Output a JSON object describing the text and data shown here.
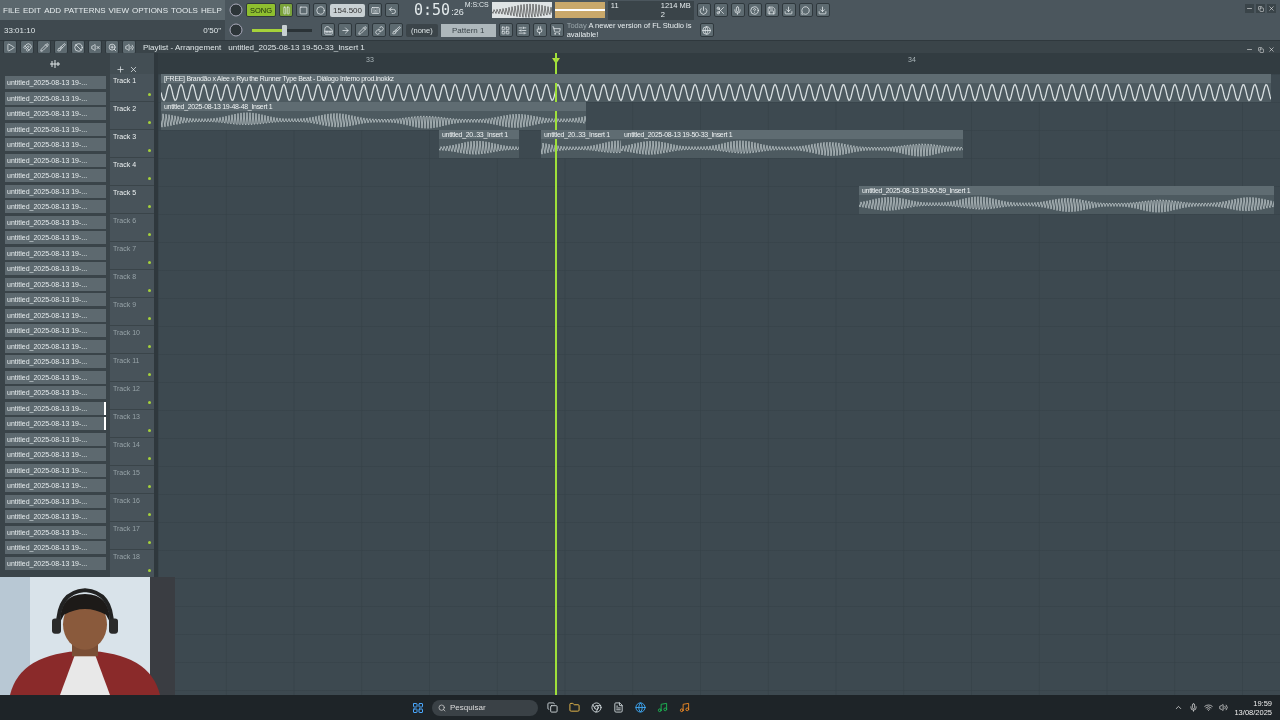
{
  "menu": [
    "FILE",
    "EDIT",
    "ADD",
    "PATTERNS",
    "VIEW",
    "OPTIONS",
    "TOOLS",
    "HELP"
  ],
  "song_position": "33:01:10",
  "hint_time": "0'50\"",
  "transport": {
    "mode_label": "SONG",
    "song_mode": true,
    "tempo": "154.500"
  },
  "master_volume": {
    "level": 0.55
  },
  "time_display": {
    "main": "0:50",
    "sub": ":26",
    "unit": "M:S:CS"
  },
  "cpu": {
    "value": "11",
    "memory": "1214 MB",
    "polyphony": "2"
  },
  "pattern": {
    "channel": "(none)",
    "name": "Pattern 1"
  },
  "notice": {
    "label": "Today",
    "text": "A newer version of FL Studio is available!"
  },
  "playlist": {
    "title": "Playlist - Arrangement",
    "pattern": "untitled_2025-08-13 19-50-33_Insert 1"
  },
  "ruler": [
    "33",
    "34"
  ],
  "browser_items": [
    {
      "label": "untitled_2025-08-13 19-...",
      "selected": false
    },
    {
      "label": "untitled_2025-08-13 19-...",
      "selected": false
    },
    {
      "label": "untitled_2025-08-13 19-...",
      "selected": false
    },
    {
      "label": "untitled_2025-08-13 19-...",
      "selected": false
    },
    {
      "label": "untitled_2025-08-13 19-...",
      "selected": false
    },
    {
      "label": "untitled_2025-08-13 19-...",
      "selected": false
    },
    {
      "label": "untitled_2025-08-13 19-...",
      "selected": false
    },
    {
      "label": "untitled_2025-08-13 19-...",
      "selected": false
    },
    {
      "label": "untitled_2025-08-13 19-...",
      "selected": false
    },
    {
      "label": "untitled_2025-08-13 19-...",
      "selected": false
    },
    {
      "label": "untitled_2025-08-13 19-...",
      "selected": false
    },
    {
      "label": "untitled_2025-08-13 19-...",
      "selected": false
    },
    {
      "label": "untitled_2025-08-13 19-...",
      "selected": false
    },
    {
      "label": "untitled_2025-08-13 19-...",
      "selected": false
    },
    {
      "label": "untitled_2025-08-13 19-...",
      "selected": false
    },
    {
      "label": "untitled_2025-08-13 19-...",
      "selected": false
    },
    {
      "label": "untitled_2025-08-13 19-...",
      "selected": false
    },
    {
      "label": "untitled_2025-08-13 19-...",
      "selected": false
    },
    {
      "label": "untitled_2025-08-13 19-...",
      "selected": false
    },
    {
      "label": "untitled_2025-08-13 19-...",
      "selected": false
    },
    {
      "label": "untitled_2025-08-13 19-...",
      "selected": false
    },
    {
      "label": "untitled_2025-08-13 19-...",
      "selected": true
    },
    {
      "label": "untitled_2025-08-13 19-...",
      "selected": true
    },
    {
      "label": "untitled_2025-08-13 19-...",
      "selected": false
    },
    {
      "label": "untitled_2025-08-13 19-...",
      "selected": false
    },
    {
      "label": "untitled_2025-08-13 19-...",
      "selected": false
    },
    {
      "label": "untitled_2025-08-13 19-...",
      "selected": false
    },
    {
      "label": "untitled_2025-08-13 19-...",
      "selected": false
    },
    {
      "label": "untitled_2025-08-13 19-...",
      "selected": false
    },
    {
      "label": "untitled_2025-08-13 19-...",
      "selected": false
    },
    {
      "label": "untitled_2025-08-13 19-...",
      "selected": false
    },
    {
      "label": "untitled_2025-08-13 19-...",
      "selected": false
    }
  ],
  "tracks": [
    {
      "name": "Track 1",
      "active": true,
      "clips": [
        {
          "label": "[FREE] Brandão x Alee x Ryu the Runner Type Beat -  Diálogo Interno   prod.inokkz",
          "kind": "tone"
        }
      ]
    },
    {
      "name": "Track 2",
      "active": true,
      "clips": [
        {
          "label": "untitled_2025-08-13 19-48-48_Insert 1",
          "kind": "voice"
        }
      ]
    },
    {
      "name": "Track 3",
      "active": true,
      "clips": [
        {
          "label": "untitled_20..33_Insert 1",
          "kind": "voice"
        },
        {
          "label": "untitled_20..33_Insert 1",
          "kind": "voice"
        },
        {
          "label": "untitled_2025-08-13 19-50-33_Insert 1",
          "kind": "voice"
        }
      ]
    },
    {
      "name": "Track 4",
      "active": true
    },
    {
      "name": "Track 5",
      "active": true,
      "clips": [
        {
          "label": "untitled_2025-08-13 19-50-59_Insert 1",
          "kind": "voice"
        }
      ]
    },
    {
      "name": "Track 6",
      "active": false
    },
    {
      "name": "Track 7",
      "active": false
    },
    {
      "name": "Track 8",
      "active": false
    },
    {
      "name": "Track 9",
      "active": false
    },
    {
      "name": "Track 10",
      "active": false
    },
    {
      "name": "Track 11",
      "active": false
    },
    {
      "name": "Track 12",
      "active": false
    },
    {
      "name": "Track 13",
      "active": false
    },
    {
      "name": "Track 14",
      "active": false
    },
    {
      "name": "Track 15",
      "active": false
    },
    {
      "name": "Track 16",
      "active": false
    },
    {
      "name": "Track 17",
      "active": false
    },
    {
      "name": "Track 18",
      "active": false
    }
  ],
  "taskbar": {
    "search_placeholder": "Pesquisar",
    "time": "19:59",
    "date": "13/08/2025"
  }
}
